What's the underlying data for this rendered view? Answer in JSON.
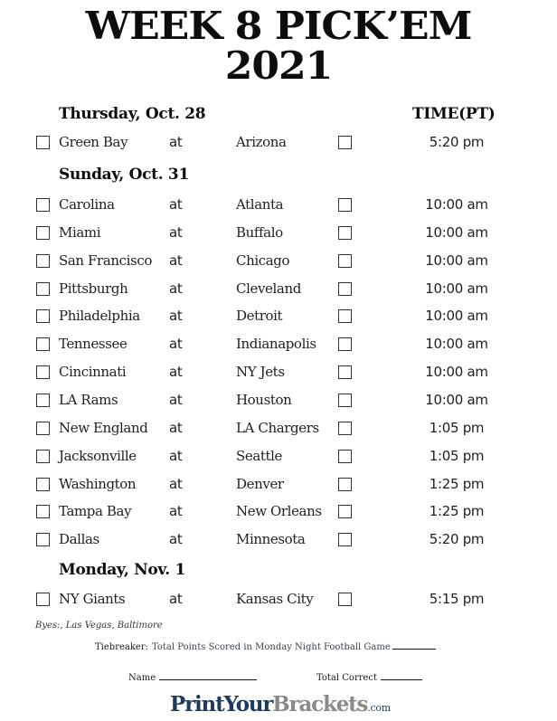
{
  "title": {
    "line1": "WEEK 8 PICK’EM",
    "line2": "2021"
  },
  "time_header": "TIME(PT)",
  "colors": {
    "text": "#1a1a1a",
    "logo_primary": "#1f3a5f",
    "logo_secondary": "#8a8a8a"
  },
  "days": [
    {
      "label": "Thursday, Oct. 28",
      "games": [
        {
          "away": "Green Bay",
          "at": "at",
          "home": "Arizona",
          "time": "5:20 pm"
        }
      ]
    },
    {
      "label": "Sunday, Oct. 31",
      "games": [
        {
          "away": "Carolina",
          "at": "at",
          "home": "Atlanta",
          "time": "10:00 am"
        },
        {
          "away": "Miami",
          "at": "at",
          "home": "Buffalo",
          "time": "10:00 am"
        },
        {
          "away": "San Francisco",
          "at": "at",
          "home": "Chicago",
          "time": "10:00 am"
        },
        {
          "away": "Pittsburgh",
          "at": "at",
          "home": "Cleveland",
          "time": "10:00 am"
        },
        {
          "away": "Philadelphia",
          "at": "at",
          "home": "Detroit",
          "time": "10:00 am"
        },
        {
          "away": "Tennessee",
          "at": "at",
          "home": "Indianapolis",
          "time": "10:00 am"
        },
        {
          "away": "Cincinnati",
          "at": "at",
          "home": "NY Jets",
          "time": "10:00 am"
        },
        {
          "away": "LA Rams",
          "at": "at",
          "home": "Houston",
          "time": "10:00 am"
        },
        {
          "away": "New England",
          "at": "at",
          "home": "LA Chargers",
          "time": "1:05 pm"
        },
        {
          "away": "Jacksonville",
          "at": "at",
          "home": "Seattle",
          "time": "1:05 pm"
        },
        {
          "away": "Washington",
          "at": "at",
          "home": "Denver",
          "time": "1:25 pm"
        },
        {
          "away": "Tampa Bay",
          "at": "at",
          "home": "New Orleans",
          "time": "1:25 pm"
        },
        {
          "away": "Dallas",
          "at": "at",
          "home": "Minnesota",
          "time": "5:20 pm"
        }
      ]
    },
    {
      "label": "Monday, Nov. 1",
      "games": [
        {
          "away": "NY Giants",
          "at": "at",
          "home": "Kansas City",
          "time": "5:15 pm"
        }
      ]
    }
  ],
  "byes": "Byes:, Las Vegas, Baltimore",
  "tiebreaker": {
    "label": "Tiebreaker:",
    "text": "Total Points Scored in Monday Night Football Game"
  },
  "name_label": "Name",
  "total_correct_label": "Total Correct",
  "logo": {
    "part1": "PrintYour",
    "part2": "Brackets",
    "part3": ".com"
  }
}
